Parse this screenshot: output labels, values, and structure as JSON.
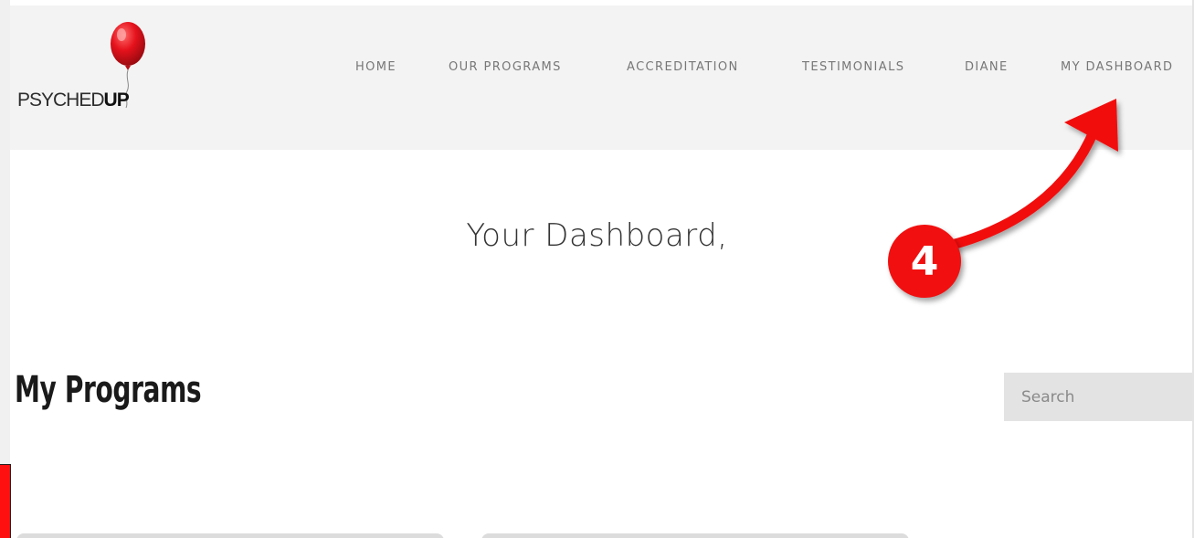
{
  "brand": {
    "logo_text_main": "PSYCHED",
    "logo_text_bold": "UP",
    "balloon_color": "#e5121c"
  },
  "nav": {
    "items": [
      {
        "label": "HOME"
      },
      {
        "label": "OUR PROGRAMS"
      },
      {
        "label": "ACCREDITATION"
      },
      {
        "label": "TESTIMONIALS"
      },
      {
        "label": "DIANE"
      },
      {
        "label": "MY DASHBOARD"
      }
    ]
  },
  "main": {
    "greeting": "Your Dashboard,",
    "section_title": "My Programs",
    "search": {
      "placeholder": "Search",
      "value": ""
    }
  },
  "annotation": {
    "step_number": "4",
    "color": "#f20f0f"
  }
}
